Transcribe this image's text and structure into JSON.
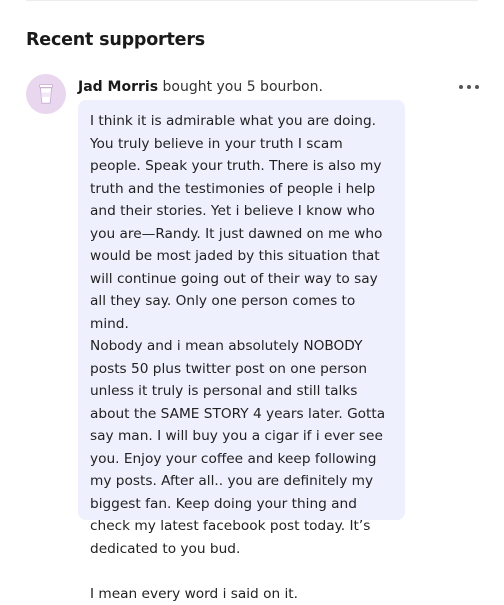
{
  "section": {
    "title": "Recent supporters"
  },
  "supporter": {
    "avatar_icon": "coffee-cup-icon",
    "avatar_color": "#e9d6ef",
    "name": "Jad Morris",
    "action": "bought you 5 bourbon.",
    "more_icon": "more-horizontal-icon",
    "message": "I think it is admirable what you are doing. You truly believe in your truth I scam people. Speak your truth. There is also my truth and the testimonies of people i help and their stories. Yet i believe I know who you are—Randy. It just dawned on me who would be most jaded by this situation that will continue going out of their way to say all they say. Only one person comes to mind.\nNobody and i mean absolutely NOBODY posts 50 plus twitter post on one person unless it truly is personal and still talks about the SAME STORY 4 years later. Gotta say man. I will buy you a cigar if i ever see you. Enjoy your coffee and keep following my posts. After all.. you are definitely my biggest fan. Keep doing your thing and check my latest facebook post today. It’s dedicated to you bud.\n\nI mean every word i said on it."
  },
  "colors": {
    "bubble_background": "#eef0fd",
    "text": "#1a1a1a"
  }
}
